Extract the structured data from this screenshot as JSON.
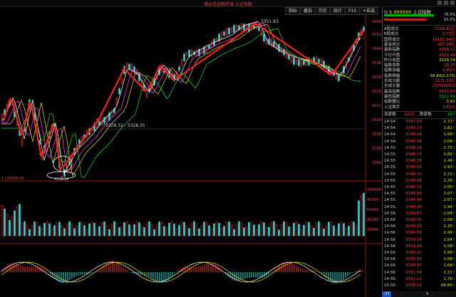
{
  "window": {
    "title": "通达信金融终端 上证指数"
  },
  "toolbar": {
    "items": [
      "指标",
      "叠加",
      "历史",
      "统计",
      "F10",
      "+自选"
    ]
  },
  "chart": {
    "price_axis": [
      "3360",
      "3352",
      "3344",
      "3336",
      "3328",
      "3320",
      "3312",
      "3304",
      "3296",
      "3288",
      "3280"
    ],
    "annotations": {
      "high": "3351.83",
      "mid_line": "3328.32 - 3328.35",
      "low": "3313.28"
    },
    "volume_label": "1 176005.00",
    "volume_axis": [
      "100000",
      "80000",
      "60000",
      "40000",
      "20000"
    ],
    "colors": {
      "up": "#ff3030",
      "down": "#30e0e0",
      "ma1": "#ffffff",
      "ma2": "#ff40ff",
      "ma3": "#e8e800",
      "ma4": "#30e030",
      "arrow": "#ff2020"
    }
  },
  "panel": {
    "code": "999999",
    "name": "上证指数",
    "prefix": "G S",
    "bars": [
      "76.0%",
      "63.0%"
    ],
    "stats": [
      {
        "k": "A股成交",
        "v": "3168.81亿",
        "c": "r"
      },
      {
        "k": "B股成交",
        "v": "2.73亿",
        "c": "r"
      },
      {
        "k": "国债成交",
        "v": "10181.94亿",
        "c": "r"
      },
      {
        "k": "基金成交",
        "v": "497.98亿",
        "c": "r"
      },
      {
        "k": "最新指数",
        "v": "3358.11",
        "c": "r"
      },
      {
        "k": "今日开盘",
        "v": "3333.49",
        "c": "r"
      },
      {
        "k": "昨日收盘",
        "v": "3329.74",
        "c": "y"
      },
      {
        "k": "指数涨跌",
        "v": "28.37",
        "c": "r"
      },
      {
        "k": "指数涨幅",
        "v": "0.85%",
        "c": "r"
      },
      {
        "k": "指数振幅",
        "v": "38.84|1.17%",
        "c": "y"
      },
      {
        "k": "总成交额",
        "v": "3171.53亿",
        "c": "r"
      },
      {
        "k": "总成交量",
        "v": "237099353",
        "c": "r"
      },
      {
        "k": "最高指数",
        "v": "3351.83",
        "c": "r"
      },
      {
        "k": "最低指数",
        "v": "3312.99",
        "c": "g"
      },
      {
        "k": "指数量比",
        "v": "0.81",
        "c": "y"
      },
      {
        "k": "上证换手",
        "v": "0.65%",
        "c": "r"
      }
    ],
    "updown": {
      "up_label": "涨家数",
      "up": "1203",
      "down_label": "跌家数",
      "down": "467"
    },
    "ticks": [
      {
        "t": "14:54",
        "p": "3347.69",
        "q": "1.73"
      },
      {
        "t": "14:54",
        "p": "3348.14",
        "q": "1.81"
      },
      {
        "t": "14:54",
        "p": "3348.26",
        "q": "1.68"
      },
      {
        "t": "14:54",
        "p": "3348.48",
        "q": "2.08"
      },
      {
        "t": "14:55",
        "p": "3348.29",
        "q": "1.75"
      },
      {
        "t": "14:55",
        "p": "3348.70",
        "q": "1.82"
      },
      {
        "t": "14:55",
        "p": "3348.70",
        "q": "1.44"
      },
      {
        "t": "14:55",
        "p": "3349.05",
        "q": "1.93"
      },
      {
        "t": "14:55",
        "p": "3349.33",
        "q": "2.22"
      },
      {
        "t": "14:55",
        "p": "3349.08",
        "q": "2.26"
      },
      {
        "t": "14:55",
        "p": "3349.10",
        "q": "2.00"
      },
      {
        "t": "14:55",
        "p": "3349.05",
        "q": "2.07"
      },
      {
        "t": "14:55",
        "p": "3349.44",
        "q": "2.07"
      },
      {
        "t": "14:55",
        "p": "3349.44",
        "q": "1.94"
      },
      {
        "t": "14:56",
        "p": "3349.87",
        "q": "2.04"
      },
      {
        "t": "14:56",
        "p": "3349.05",
        "q": "2.08"
      },
      {
        "t": "14:56",
        "p": "3349.20",
        "q": "2.35"
      },
      {
        "t": "14:56",
        "p": "3349.58",
        "q": "2.49"
      },
      {
        "t": "14:56",
        "p": "3359.26",
        "q": "1.64"
      },
      {
        "t": "14:56",
        "p": "3359.49",
        "q": "1.58"
      },
      {
        "t": "14:56",
        "p": "3350.23",
        "q": "1.99"
      },
      {
        "t": "14:56",
        "p": "3350.90",
        "q": "1.68"
      },
      {
        "t": "14:56",
        "p": "3350.87",
        "q": "1.68"
      },
      {
        "t": "14:56",
        "p": "3352.08",
        "q": "2.21"
      },
      {
        "t": "14:56",
        "p": "3352.12",
        "q": "1.76"
      },
      {
        "t": "15:00",
        "p": "3358.11",
        "q": "68.85"
      }
    ],
    "bottom": {
      "left": "-37",
      "right": "5"
    }
  }
}
